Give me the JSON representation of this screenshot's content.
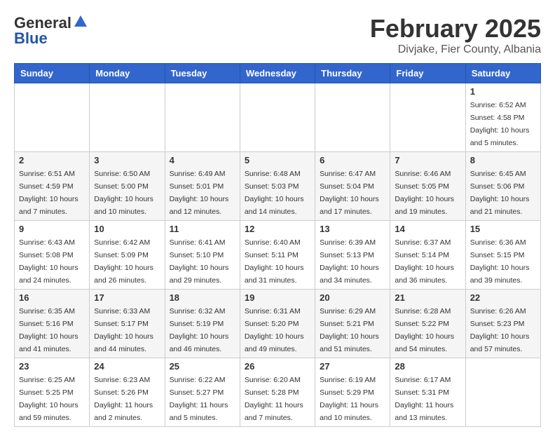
{
  "header": {
    "logo_general": "General",
    "logo_blue": "Blue",
    "month": "February 2025",
    "location": "Divjake, Fier County, Albania"
  },
  "weekdays": [
    "Sunday",
    "Monday",
    "Tuesday",
    "Wednesday",
    "Thursday",
    "Friday",
    "Saturday"
  ],
  "weeks": [
    [
      {
        "day": "",
        "info": ""
      },
      {
        "day": "",
        "info": ""
      },
      {
        "day": "",
        "info": ""
      },
      {
        "day": "",
        "info": ""
      },
      {
        "day": "",
        "info": ""
      },
      {
        "day": "",
        "info": ""
      },
      {
        "day": "1",
        "info": "Sunrise: 6:52 AM\nSunset: 4:58 PM\nDaylight: 10 hours\nand 5 minutes."
      }
    ],
    [
      {
        "day": "2",
        "info": "Sunrise: 6:51 AM\nSunset: 4:59 PM\nDaylight: 10 hours\nand 7 minutes."
      },
      {
        "day": "3",
        "info": "Sunrise: 6:50 AM\nSunset: 5:00 PM\nDaylight: 10 hours\nand 10 minutes."
      },
      {
        "day": "4",
        "info": "Sunrise: 6:49 AM\nSunset: 5:01 PM\nDaylight: 10 hours\nand 12 minutes."
      },
      {
        "day": "5",
        "info": "Sunrise: 6:48 AM\nSunset: 5:03 PM\nDaylight: 10 hours\nand 14 minutes."
      },
      {
        "day": "6",
        "info": "Sunrise: 6:47 AM\nSunset: 5:04 PM\nDaylight: 10 hours\nand 17 minutes."
      },
      {
        "day": "7",
        "info": "Sunrise: 6:46 AM\nSunset: 5:05 PM\nDaylight: 10 hours\nand 19 minutes."
      },
      {
        "day": "8",
        "info": "Sunrise: 6:45 AM\nSunset: 5:06 PM\nDaylight: 10 hours\nand 21 minutes."
      }
    ],
    [
      {
        "day": "9",
        "info": "Sunrise: 6:43 AM\nSunset: 5:08 PM\nDaylight: 10 hours\nand 24 minutes."
      },
      {
        "day": "10",
        "info": "Sunrise: 6:42 AM\nSunset: 5:09 PM\nDaylight: 10 hours\nand 26 minutes."
      },
      {
        "day": "11",
        "info": "Sunrise: 6:41 AM\nSunset: 5:10 PM\nDaylight: 10 hours\nand 29 minutes."
      },
      {
        "day": "12",
        "info": "Sunrise: 6:40 AM\nSunset: 5:11 PM\nDaylight: 10 hours\nand 31 minutes."
      },
      {
        "day": "13",
        "info": "Sunrise: 6:39 AM\nSunset: 5:13 PM\nDaylight: 10 hours\nand 34 minutes."
      },
      {
        "day": "14",
        "info": "Sunrise: 6:37 AM\nSunset: 5:14 PM\nDaylight: 10 hours\nand 36 minutes."
      },
      {
        "day": "15",
        "info": "Sunrise: 6:36 AM\nSunset: 5:15 PM\nDaylight: 10 hours\nand 39 minutes."
      }
    ],
    [
      {
        "day": "16",
        "info": "Sunrise: 6:35 AM\nSunset: 5:16 PM\nDaylight: 10 hours\nand 41 minutes."
      },
      {
        "day": "17",
        "info": "Sunrise: 6:33 AM\nSunset: 5:17 PM\nDaylight: 10 hours\nand 44 minutes."
      },
      {
        "day": "18",
        "info": "Sunrise: 6:32 AM\nSunset: 5:19 PM\nDaylight: 10 hours\nand 46 minutes."
      },
      {
        "day": "19",
        "info": "Sunrise: 6:31 AM\nSunset: 5:20 PM\nDaylight: 10 hours\nand 49 minutes."
      },
      {
        "day": "20",
        "info": "Sunrise: 6:29 AM\nSunset: 5:21 PM\nDaylight: 10 hours\nand 51 minutes."
      },
      {
        "day": "21",
        "info": "Sunrise: 6:28 AM\nSunset: 5:22 PM\nDaylight: 10 hours\nand 54 minutes."
      },
      {
        "day": "22",
        "info": "Sunrise: 6:26 AM\nSunset: 5:23 PM\nDaylight: 10 hours\nand 57 minutes."
      }
    ],
    [
      {
        "day": "23",
        "info": "Sunrise: 6:25 AM\nSunset: 5:25 PM\nDaylight: 10 hours\nand 59 minutes."
      },
      {
        "day": "24",
        "info": "Sunrise: 6:23 AM\nSunset: 5:26 PM\nDaylight: 11 hours\nand 2 minutes."
      },
      {
        "day": "25",
        "info": "Sunrise: 6:22 AM\nSunset: 5:27 PM\nDaylight: 11 hours\nand 5 minutes."
      },
      {
        "day": "26",
        "info": "Sunrise: 6:20 AM\nSunset: 5:28 PM\nDaylight: 11 hours\nand 7 minutes."
      },
      {
        "day": "27",
        "info": "Sunrise: 6:19 AM\nSunset: 5:29 PM\nDaylight: 11 hours\nand 10 minutes."
      },
      {
        "day": "28",
        "info": "Sunrise: 6:17 AM\nSunset: 5:31 PM\nDaylight: 11 hours\nand 13 minutes."
      },
      {
        "day": "",
        "info": ""
      }
    ]
  ]
}
